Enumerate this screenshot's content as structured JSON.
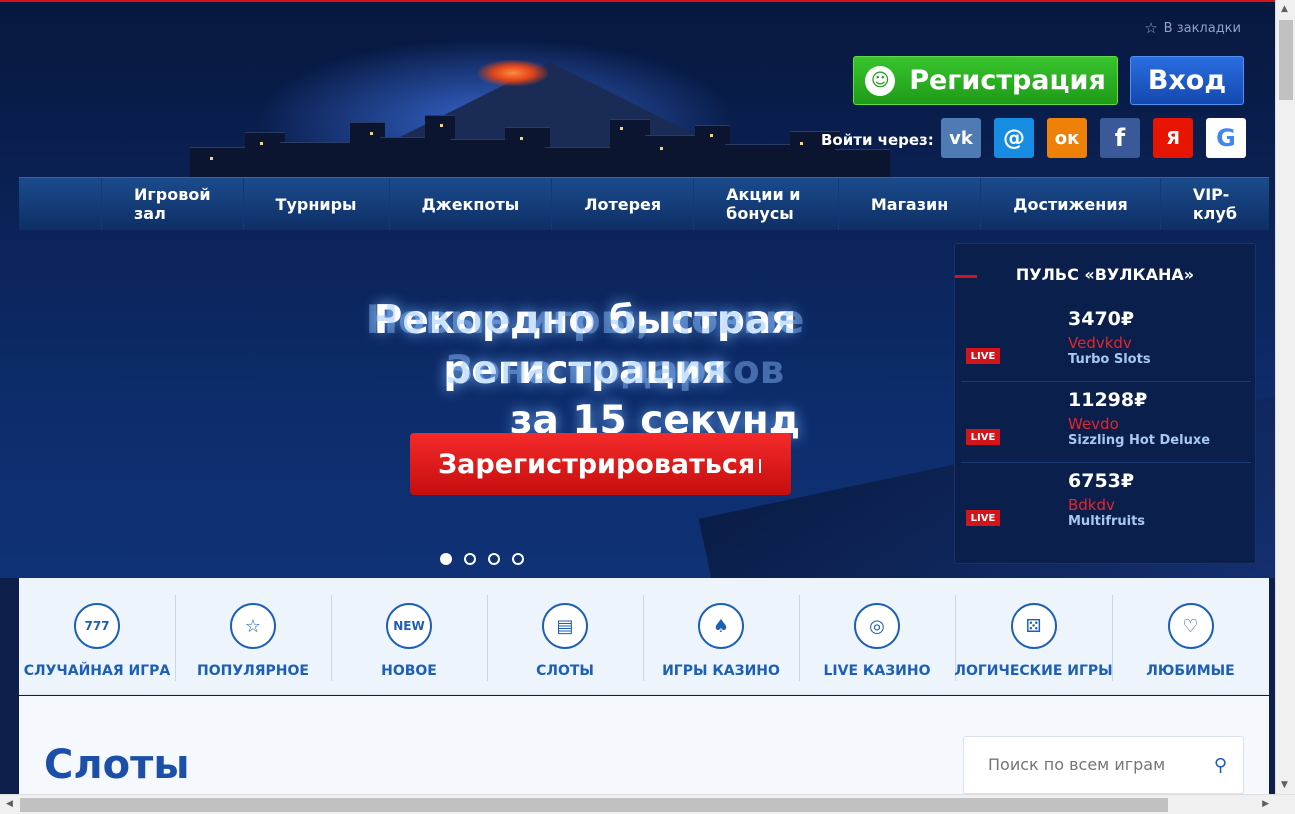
{
  "header": {
    "bookmark_label": "В закладки",
    "register_label": "Регистрация",
    "login_label": "Вход",
    "login_via_label": "Войти через:",
    "socials": [
      {
        "name": "vk",
        "label": "vk"
      },
      {
        "name": "mail",
        "label": "@"
      },
      {
        "name": "ok",
        "label": "ок"
      },
      {
        "name": "fb",
        "label": "f"
      },
      {
        "name": "ya",
        "label": "Я"
      },
      {
        "name": "google",
        "label": "G"
      }
    ]
  },
  "nav": {
    "items": [
      "Игровой зал",
      "Турниры",
      "Джекпоты",
      "Лотерея",
      "Акции и бонусы",
      "Магазин",
      "Достижения",
      "VIP-клуб"
    ]
  },
  "hero": {
    "title_line1": "Рекордно быстрая регистрация",
    "title_line2": "за 15 секунд",
    "ghost_line1": "Новые игры, новые",
    "ghost_line2": "Зона подарков",
    "cta_label": "Зарегистрироваться",
    "slide_count": 4,
    "active_slide": 1
  },
  "pulse": {
    "title": "ПУЛЬС «ВУЛКАНА»",
    "live_label": "LIVE",
    "rows": [
      {
        "amount": "3470₽",
        "user": "Vedvkdv",
        "game": "Turbo Slots"
      },
      {
        "amount": "11298₽",
        "user": "Wevdo",
        "game": "Sizzling Hot Deluxe"
      },
      {
        "amount": "6753₽",
        "user": "Bdkdv",
        "game": "Multifruits"
      }
    ]
  },
  "categories": [
    {
      "label": "СЛУЧАЙНАЯ ИГРА",
      "icon": "777"
    },
    {
      "label": "ПОПУЛЯРНОЕ",
      "icon": "☆"
    },
    {
      "label": "НОВОЕ",
      "icon": "NEW"
    },
    {
      "label": "СЛОТЫ",
      "icon": "▤"
    },
    {
      "label": "ИГРЫ КАЗИНО",
      "icon": "♠"
    },
    {
      "label": "LIVE КАЗИНО",
      "icon": "◎"
    },
    {
      "label": "ЛОГИЧЕСКИЕ ИГРЫ",
      "icon": "⚄"
    },
    {
      "label": "ЛЮБИМЫЕ",
      "icon": "♡"
    }
  ],
  "content": {
    "section_title": "Слоты",
    "search_placeholder": "Поиск по всем играм"
  },
  "colors": {
    "accent_red": "#d3141b",
    "brand_blue": "#1c5fb8",
    "register_green": "#1f9b18"
  }
}
